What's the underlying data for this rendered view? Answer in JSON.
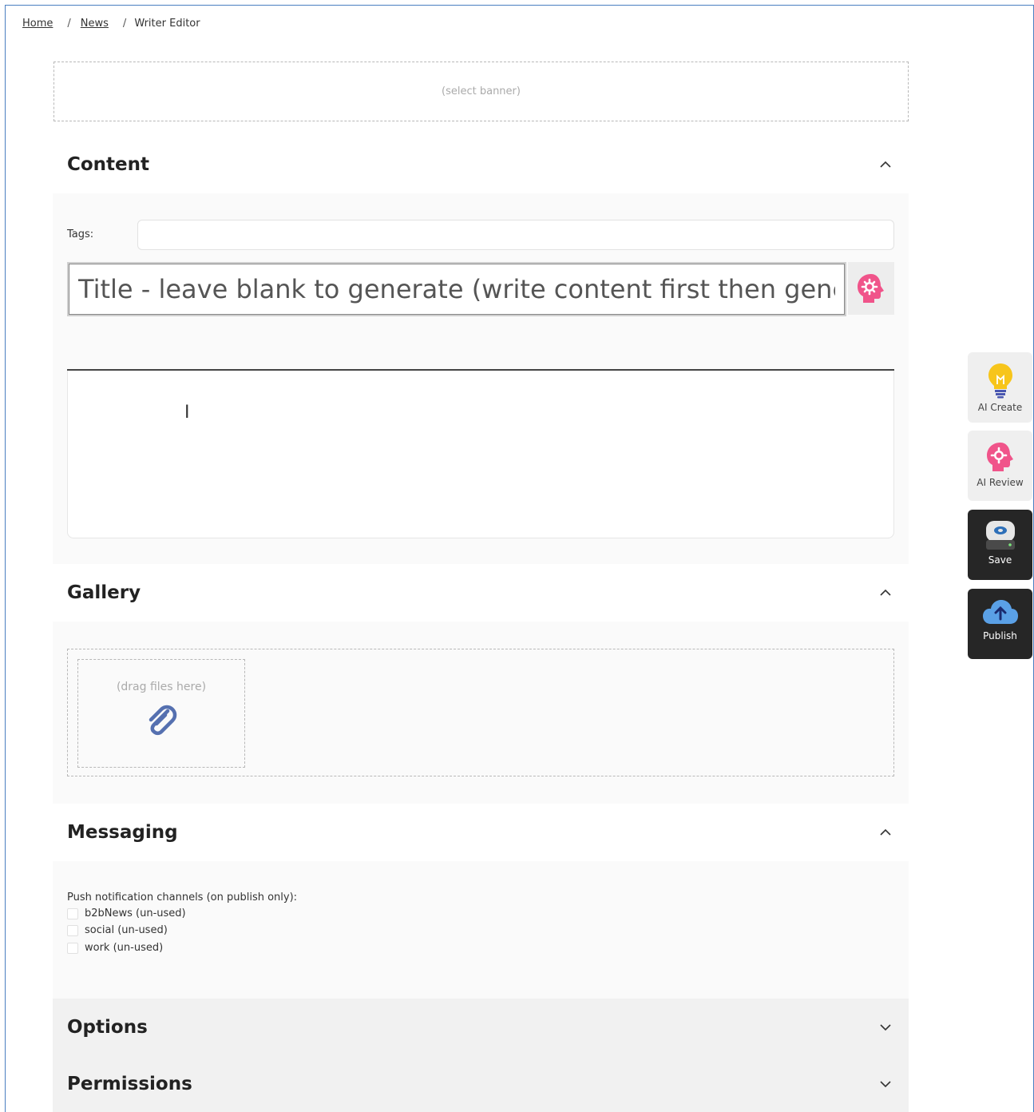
{
  "breadcrumb": {
    "home": "Home",
    "news": "News",
    "current": "Writer Editor",
    "separator": "/"
  },
  "banner": {
    "placeholder": "(select banner)"
  },
  "content": {
    "title": "Content",
    "tags_label": "Tags:",
    "tags_value": "",
    "title_placeholder": "Title - leave blank to generate (write content first then generate)",
    "title_ai_icon": "ai-head-gear-icon"
  },
  "gallery": {
    "title": "Gallery",
    "drop_hint": "(drag files here)",
    "icon": "paperclip-icon"
  },
  "messaging": {
    "title": "Messaging",
    "channels_label": "Push notification channels (on publish only):",
    "channels": [
      {
        "label": "b2bNews (un-used)",
        "checked": false
      },
      {
        "label": "social (un-used)",
        "checked": false
      },
      {
        "label": "work (un-used)",
        "checked": false
      }
    ]
  },
  "options": {
    "title": "Options"
  },
  "permissions": {
    "title": "Permissions"
  },
  "side_actions": {
    "ai_create": {
      "label": "AI Create",
      "icon": "lightbulb-icon"
    },
    "ai_review": {
      "label": "AI Review",
      "icon": "ai-head-gear-icon"
    },
    "save": {
      "label": "Save",
      "icon": "disk-drive-icon"
    },
    "publish": {
      "label": "Publish",
      "icon": "cloud-upload-icon"
    }
  },
  "colors": {
    "frame_border": "#4a7fc1",
    "ai_pink": "#f0548a",
    "bulb_yellow": "#f7c51b",
    "publish_blue": "#5aa0e6",
    "dark_button": "#262626"
  }
}
